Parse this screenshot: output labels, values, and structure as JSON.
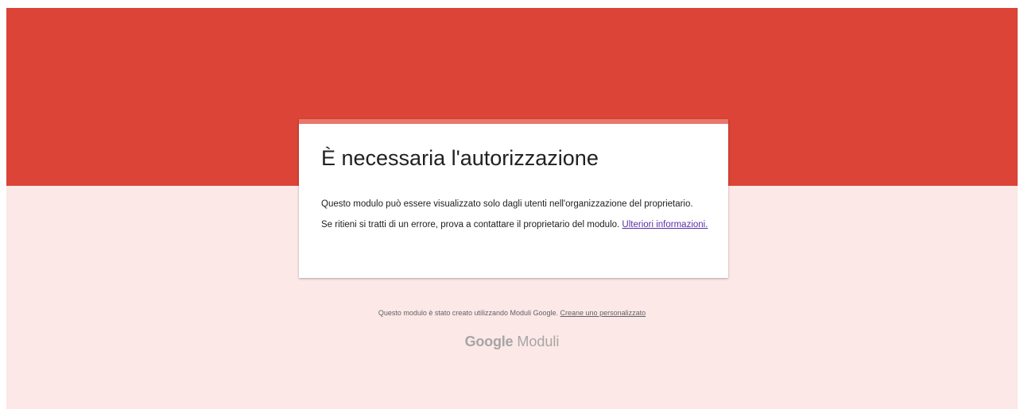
{
  "colors": {
    "banner": "#db4437",
    "page_background": "#fce8e6",
    "card_accent": "#e8776c",
    "link": "#5b2fa8"
  },
  "card": {
    "title": "È necessaria l'autorizzazione",
    "message_1": "Questo modulo può essere visualizzato solo dagli utenti nell'organizzazione del proprietario.",
    "message_2": "Se ritieni si tratti di un errore, prova a contattare il proprietario del modulo.",
    "learn_more_link": "Ulteriori informazioni."
  },
  "footer": {
    "note": "Questo modulo è stato creato utilizzando Moduli Google.",
    "create_link": "Creane uno personalizzato",
    "brand_google": "Google",
    "brand_product": "Moduli"
  }
}
